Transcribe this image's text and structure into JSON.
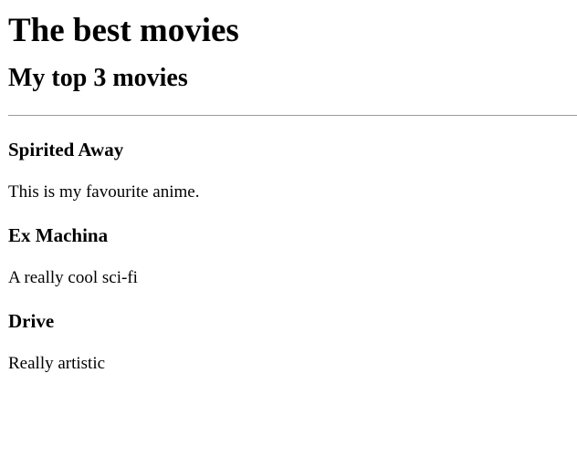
{
  "page": {
    "title": "The best movies",
    "subtitle": "My top 3 movies"
  },
  "movies": [
    {
      "title": "Spirited Away",
      "description": "This is my favourite anime."
    },
    {
      "title": "Ex Machina",
      "description": "A really cool sci-fi"
    },
    {
      "title": "Drive",
      "description": "Really artistic"
    }
  ]
}
